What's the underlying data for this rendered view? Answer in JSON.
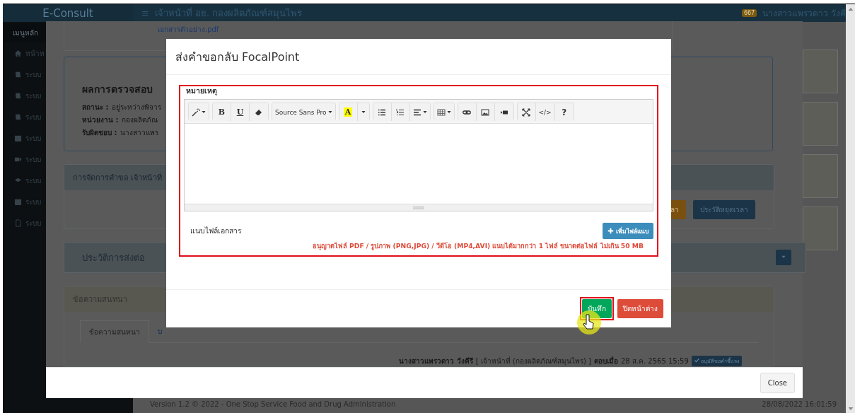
{
  "header": {
    "brand": "E-Consult",
    "menu_icon": "≡",
    "title": "เจ้าหน้าที่ อย. กองผลิตภัณฑ์สมุนไพร",
    "notification_count": "667",
    "user": "นางสาวแพรวดาว วังคี"
  },
  "sidebar": {
    "heading": "เมนูหลัก",
    "items": [
      {
        "label": "หน้าห"
      },
      {
        "label": "ระบบ"
      },
      {
        "label": "ระบบ"
      },
      {
        "label": "ระบบ"
      },
      {
        "label": "ระบบ"
      },
      {
        "label": "ระบบ"
      },
      {
        "label": "ระบบ"
      },
      {
        "label": "ระบบ"
      },
      {
        "label": "ระบบ"
      }
    ]
  },
  "background_modal": {
    "file_link": "เอกสารตัวอย่าง.pdf",
    "result_title": "ผลการตรวจสอบ",
    "result_fields": [
      {
        "label": "สถานะ :",
        "value": "อยู่ระหว่างพิจาร"
      },
      {
        "label": "หน่วยงาน :",
        "value": "กองผลิตภัณ"
      },
      {
        "label": "รับผิดชอบ :",
        "value": "นางสาวแพร"
      }
    ],
    "manage_section": {
      "title": "การจัดการคำขอ เจ้าหน้าที่",
      "buttons": [
        {
          "label": "ลา",
          "kind": "warning"
        },
        {
          "label": "ประวัติหยุดเวลา",
          "kind": "primary"
        }
      ]
    },
    "forward_section": {
      "title": "ประวัติการส่งต่อ"
    },
    "chat_section": {
      "title": "ข้อความสนทนา",
      "tabs": [
        {
          "label": "ข้อความสนทนา",
          "selected": true
        },
        {
          "label": "บ",
          "selected": false
        }
      ],
      "message": {
        "author": "นางสาวแพรวดาว วังคีรี",
        "role": "[ เจ้าหน้าที่ (กองผลิตภัณฑ์สมุนไพร) ]",
        "replied_label": "ตอบเมื่อ",
        "time": "28 ส.ค. 2565 15:59",
        "badge": "อนุมัติขอคำชี้แจง"
      }
    },
    "close_button": "Close"
  },
  "footer": {
    "version": "Version 1.2 © 2022 - One Stop Service Food and Drug Administration",
    "datetime": "28/08/2022 16:01:59"
  },
  "dialog": {
    "title": "ส่งคำขอกลับ FocalPoint",
    "note_label": "หมายเหตุ",
    "toolbar": [
      [
        {
          "kind": "icon"
        }
      ],
      [
        {
          "kind": "text",
          "label": "B"
        },
        {
          "kind": "text",
          "label": "U"
        },
        {
          "kind": "icon"
        }
      ],
      [
        {
          "kind": "font",
          "label": "Source Sans Pro"
        }
      ],
      [
        {
          "kind": "color",
          "label": "A"
        },
        {
          "kind": "caret"
        }
      ],
      [
        {
          "kind": "icon"
        },
        {
          "kind": "icon"
        },
        {
          "kind": "icon"
        }
      ],
      [
        {
          "kind": "icon"
        }
      ],
      [
        {
          "kind": "icon"
        },
        {
          "kind": "icon"
        },
        {
          "kind": "icon"
        }
      ],
      [
        {
          "kind": "icon"
        },
        {
          "kind": "text",
          "label": "</>"
        },
        {
          "kind": "text",
          "label": "?"
        }
      ]
    ],
    "attach_label": "แนบไฟล์เอกสาร",
    "add_file_button": "เพิ่มไฟล์แนบ",
    "file_note": "อนุญาตไฟล์ PDF / รูปภาพ (PNG,JPG) / วีดีโอ (MP4,AVI) แนบได้มากกว่า 1 ไฟล์ ขนาดต่อไฟล์ ไม่เกิน 50 MB",
    "save_button": "บันทึก",
    "close_button": "ปิดหน้าต่าง"
  }
}
